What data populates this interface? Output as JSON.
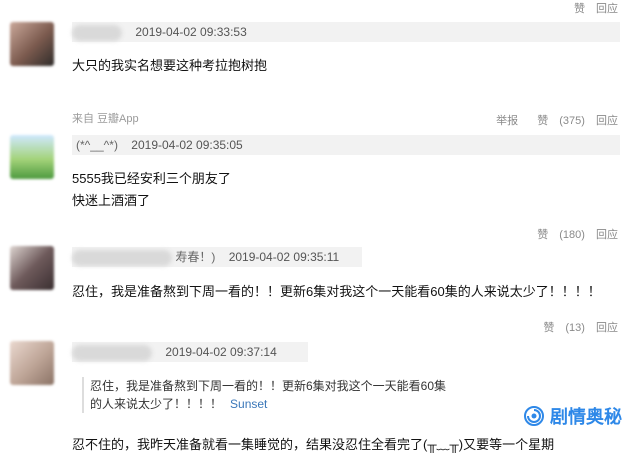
{
  "comments": [
    {
      "name_visible": "",
      "time": "2019-04-02 09:33:53",
      "lines": [
        "大只的我实名想要这种考拉抱树抱"
      ],
      "source": "来自 豆瓣App",
      "useful_label": "赞",
      "useful_count": "",
      "reply_label": "回应"
    },
    {
      "name_visible": "(*^__^*)",
      "time": "2019-04-02 09:35:05",
      "lines": [
        "5555我已经安利三个朋友了",
        "快迷上酒酒了"
      ],
      "report_label": "举报",
      "useful_label": "赞",
      "useful_count": "(375)",
      "reply_label": "回应"
    },
    {
      "name_visible": "寿春！)",
      "time": "2019-04-02 09:35:11",
      "lines": [
        "忍住，我是准备熬到下周一看的！！更新6集对我这个一天能看60集的人来说太少了！！！！"
      ],
      "useful_label": "赞",
      "useful_count": "(180)",
      "reply_label": "回应"
    },
    {
      "name_visible": "",
      "time": "2019-04-02 09:37:14",
      "quote_lines": [
        "忍住，我是准备熬到下周一看的！！更新6集对我这个一天能看60集",
        "的人来说太少了！！！！"
      ],
      "quote_author": "Sunset",
      "lines": [
        "忍不住的，我昨天准备就看一集睡觉的，结果没忍住全看完了(╥﹏╥)又要等一个星期"
      ],
      "useful_label": "赞",
      "useful_count": "(13)",
      "reply_label": "回应"
    }
  ],
  "watermark": {
    "text": "剧情奥秘",
    "color": "#2e88e8"
  }
}
